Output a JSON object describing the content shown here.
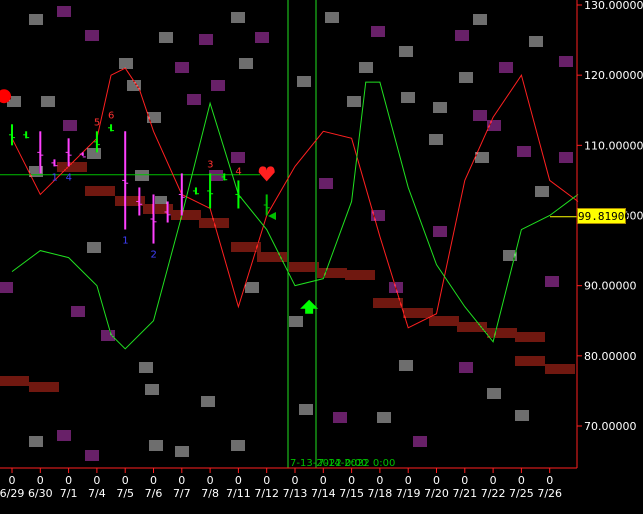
{
  "chart_data": {
    "type": "line",
    "title": "",
    "xlabel": "",
    "ylabel": "",
    "ylim": [
      63.0,
      131.0
    ],
    "y_ticks": [
      "130.00000",
      "120.00000",
      "110.00000",
      "100.00000",
      "90.00000",
      "80.00000",
      "70.00000"
    ],
    "y_tick_values": [
      130,
      120,
      110,
      100,
      90,
      80,
      70
    ],
    "x_ticks": [
      "6/29",
      "6/30",
      "7/1",
      "7/4",
      "7/5",
      "7/6",
      "7/7",
      "7/8",
      "7/11",
      "7/12",
      "7/13",
      "7/14",
      "7/15",
      "7/18",
      "7/19",
      "7/20",
      "7/21",
      "7/22",
      "7/25",
      "7/26"
    ],
    "x_tick_zero": "0",
    "current_price": "99.81900",
    "current_value": 99.819,
    "horizontal_line_value": 105.8,
    "vertical_line_labels": [
      "7-13-2022 0:00",
      "7-14-2022 0:00"
    ],
    "grid": false,
    "series": [
      {
        "color": "#ff2020",
        "x": [
          0,
          1,
          2,
          3,
          3.5,
          4,
          4.5,
          5,
          6,
          7,
          8,
          9,
          10,
          11,
          12,
          13,
          14,
          15,
          16,
          17,
          18,
          19,
          20
        ],
        "values": [
          111,
          103,
          107,
          111,
          120,
          121,
          118,
          112,
          103,
          101,
          87,
          100,
          107,
          112,
          111,
          97,
          84,
          86,
          105,
          114,
          120,
          105,
          102
        ]
      },
      {
        "color": "#20e020",
        "x": [
          0,
          1,
          2,
          3,
          3.5,
          4,
          5,
          6,
          7,
          8,
          9,
          10,
          11,
          12,
          12.5,
          13,
          14,
          15,
          16,
          17,
          18,
          19,
          20
        ],
        "values": [
          92,
          95,
          94,
          90,
          83,
          81,
          85,
          100,
          116,
          103,
          98,
          90,
          91,
          102,
          119,
          119,
          104,
          93,
          87,
          82,
          98,
          100,
          103
        ]
      }
    ],
    "price_bars": [
      {
        "x": 0.0,
        "high": 113,
        "low": 110,
        "color": "#00ff00",
        "label": ""
      },
      {
        "x": 0.5,
        "high": 112,
        "low": 111,
        "color": "#00ff00",
        "label": ""
      },
      {
        "x": 1.0,
        "high": 112,
        "low": 106,
        "color": "#ff40ff",
        "label": ""
      },
      {
        "x": 1.5,
        "high": 108,
        "low": 107,
        "color": "#ff40ff",
        "label": "1"
      },
      {
        "x": 2.0,
        "high": 111,
        "low": 107,
        "color": "#ff40ff",
        "label": "4"
      },
      {
        "x": 2.5,
        "high": 109,
        "low": 108.5,
        "color": "#ff40ff",
        "label": ""
      },
      {
        "x": 3.0,
        "high": 112,
        "low": 109,
        "color": "#00ff00",
        "label": "5"
      },
      {
        "x": 3.5,
        "high": 113,
        "low": 112,
        "color": "#00ff00",
        "label": "6"
      },
      {
        "x": 4.0,
        "high": 112,
        "low": 98,
        "color": "#ff40ff",
        "label": "1"
      },
      {
        "x": 4.5,
        "high": 104,
        "low": 100,
        "color": "#ff40ff",
        "label": ""
      },
      {
        "x": 5.0,
        "high": 103,
        "low": 96,
        "color": "#ff40ff",
        "label": "2"
      },
      {
        "x": 5.5,
        "high": 102,
        "low": 99,
        "color": "#ff40ff",
        "label": ""
      },
      {
        "x": 6.0,
        "high": 106,
        "low": 100,
        "color": "#ff40ff",
        "label": ""
      },
      {
        "x": 6.5,
        "high": 104,
        "low": 103,
        "color": "#00ff00",
        "label": ""
      },
      {
        "x": 7.0,
        "high": 106,
        "low": 101,
        "color": "#00ff00",
        "label": "3"
      },
      {
        "x": 7.5,
        "high": 106,
        "low": 105,
        "color": "#00ff00",
        "label": ""
      },
      {
        "x": 8.0,
        "high": 105,
        "low": 101,
        "color": "#00ff00",
        "label": "4"
      },
      {
        "x": 9.0,
        "high": 103,
        "low": 100,
        "color": "#00c000",
        "label": ""
      }
    ],
    "markers": [
      {
        "type": "red-circle",
        "x": 0.0,
        "y": 117
      },
      {
        "type": "red-heart",
        "x": 9.0,
        "y": 106
      },
      {
        "type": "green-up-arrow",
        "x": 10.5,
        "y": 88
      }
    ]
  }
}
